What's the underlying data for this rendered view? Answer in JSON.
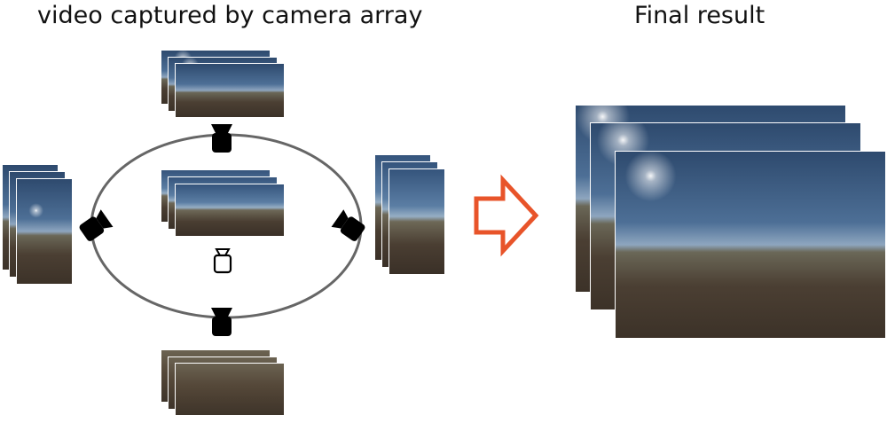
{
  "titles": {
    "left": "video captured by camera array",
    "right": "Final result"
  },
  "colors": {
    "arrow": "#e8542a",
    "ring": "#666666",
    "camera": "#000000"
  },
  "icons": {
    "cameras": "camera-icon",
    "viewer": "viewer-camera-icon",
    "arrow": "right-arrow-icon"
  }
}
